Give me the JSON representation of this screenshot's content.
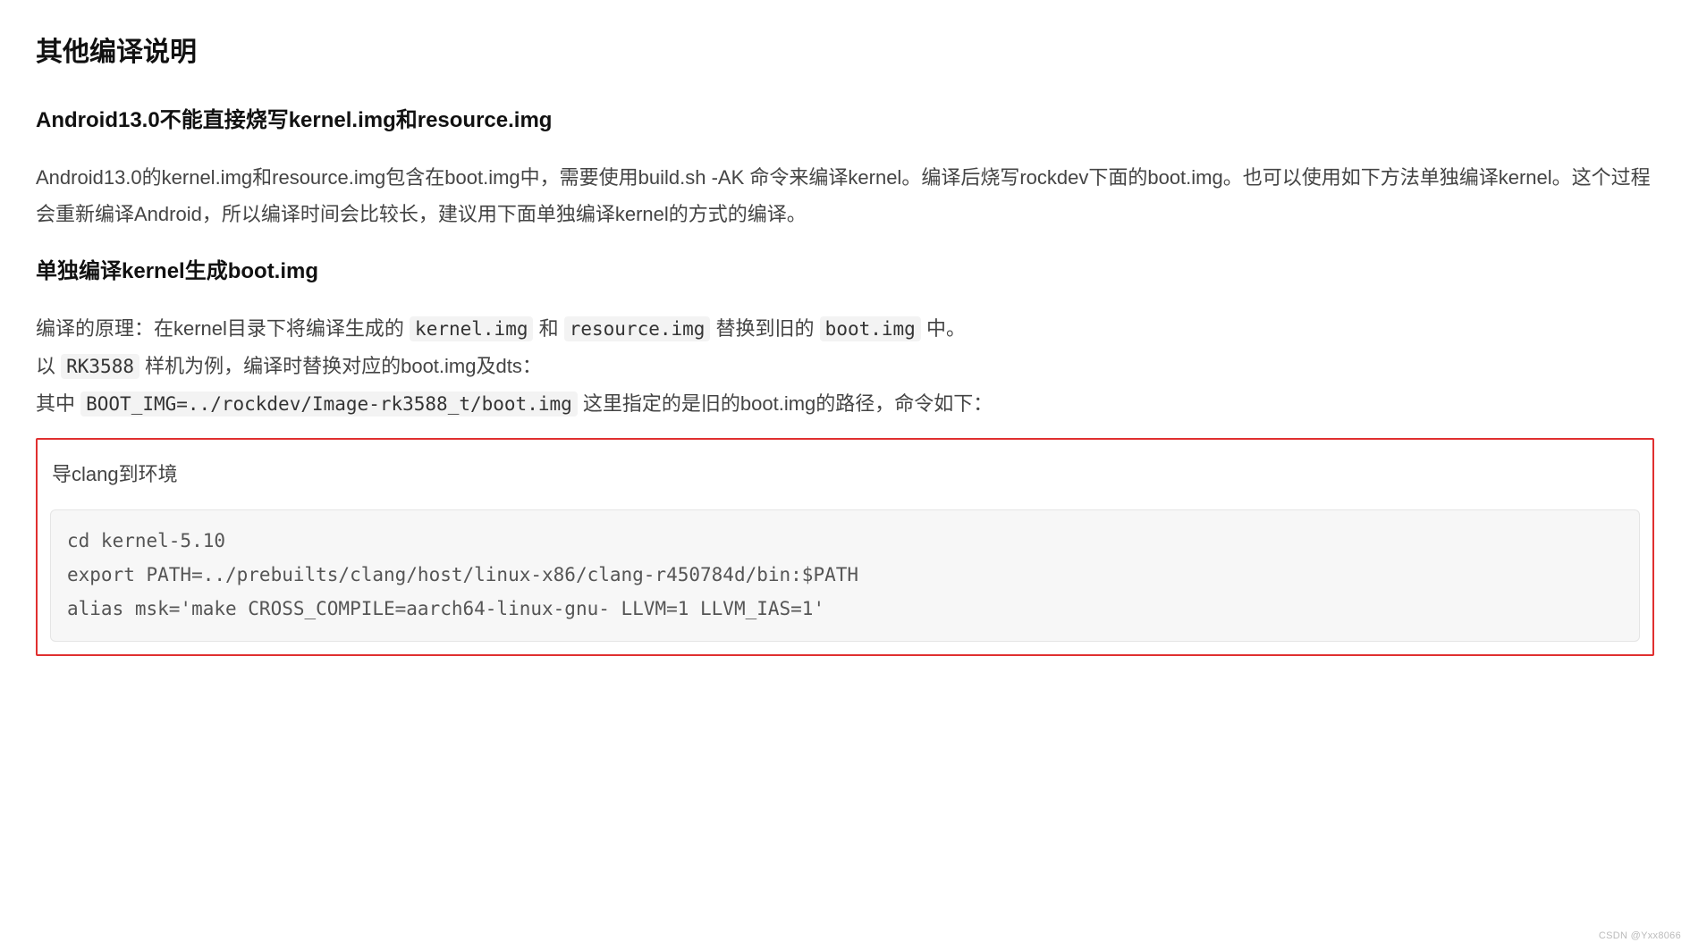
{
  "h2": "其他编译说明",
  "h3a": "Android13.0不能直接烧写kernel.img和resource.img",
  "p1": "Android13.0的kernel.img和resource.img包含在boot.img中，需要使用build.sh -AK 命令来编译kernel。编译后烧写rockdev下面的boot.img。也可以使用如下方法单独编译kernel。这个过程会重新编译Android，所以编译时间会比较长，建议用下面单独编译kernel的方式的编译。",
  "h3b": "单独编译kernel生成boot.img",
  "p2": {
    "s1": "编译的原理：在kernel目录下将编译生成的 ",
    "c1": "kernel.img",
    "s2": " 和 ",
    "c2": "resource.img",
    "s3": " 替换到旧的 ",
    "c3": "boot.img",
    "s4": " 中。"
  },
  "p3": {
    "s1": "以 ",
    "c1": "RK3588",
    "s2": " 样机为例，编译时替换对应的boot.img及dts："
  },
  "p4": {
    "s1": "其中 ",
    "c1": "BOOT_IMG=../rockdev/Image-rk3588_t/boot.img",
    "s2": " 这里指定的是旧的boot.img的路径，命令如下："
  },
  "box": {
    "title": "导clang到环境",
    "code": "cd kernel-5.10\nexport PATH=../prebuilts/clang/host/linux-x86/clang-r450784d/bin:$PATH\nalias msk='make CROSS_COMPILE=aarch64-linux-gnu- LLVM=1 LLVM_IAS=1'"
  },
  "watermark": "CSDN @Yxx8066"
}
